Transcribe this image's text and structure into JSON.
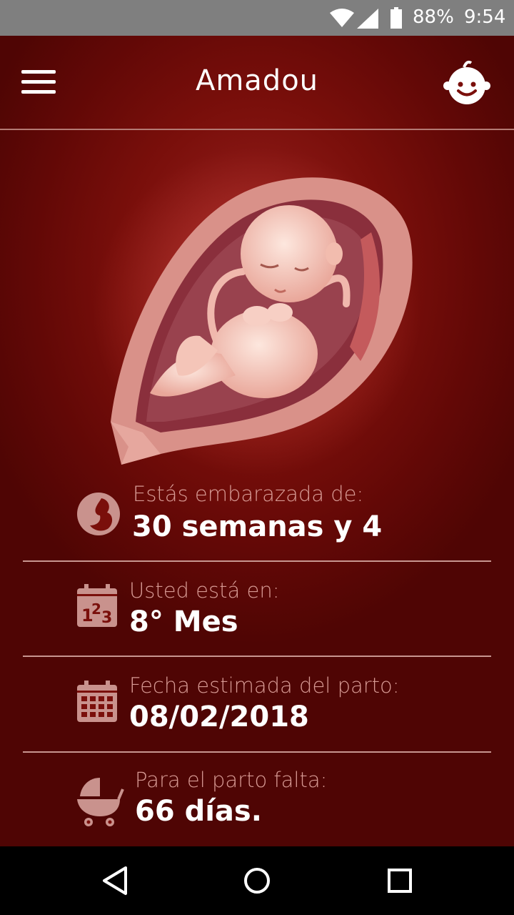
{
  "status_bar": {
    "battery": "88%",
    "time": "9:54"
  },
  "header": {
    "title": "Amadou"
  },
  "rows": [
    {
      "label": "Estás embarazada de:",
      "value": "30 semanas y 4"
    },
    {
      "label": "Usted está en:",
      "value": "8° Mes"
    },
    {
      "label": "Fecha estimada del parto:",
      "value": "08/02/2018"
    },
    {
      "label": "Para el parto falta:",
      "value": "66 días."
    }
  ],
  "colors": {
    "background": "#7a0f0b",
    "label": "#d79a94",
    "icon": "#c9928d",
    "status_bar": "#7f7f7f"
  }
}
